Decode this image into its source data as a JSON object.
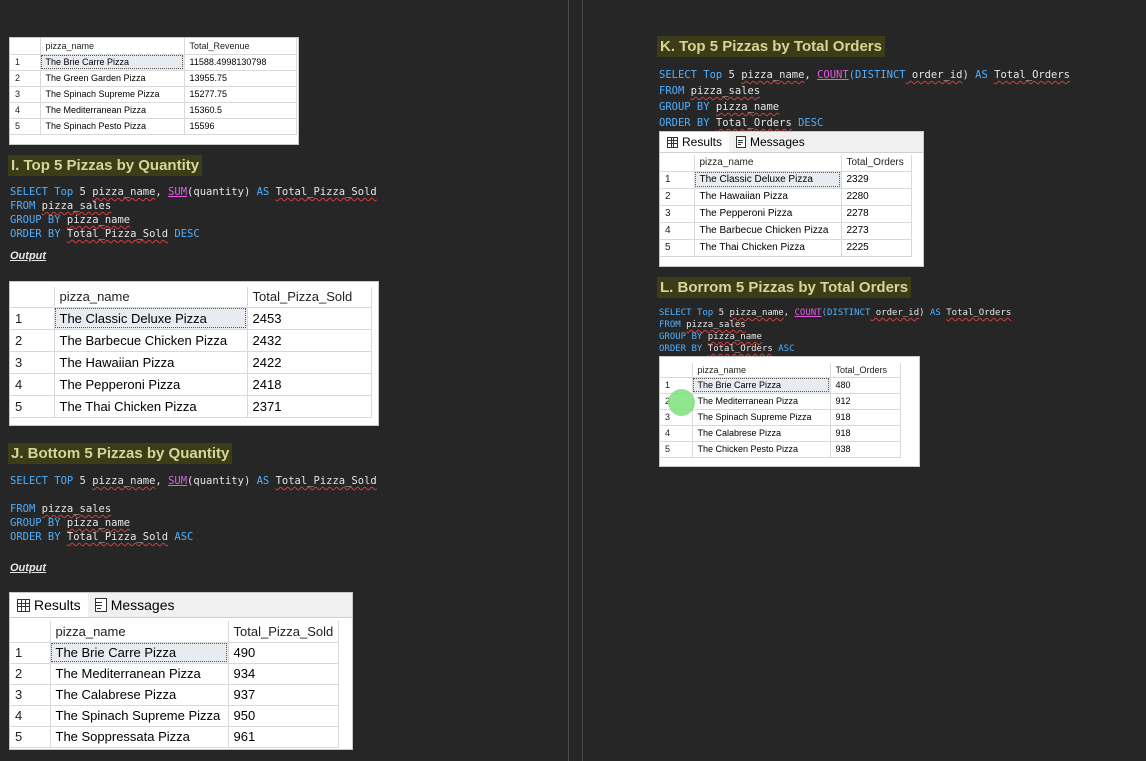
{
  "top_partial_table": {
    "columns": [
      "pizza_name",
      "Total_Revenue"
    ],
    "rows": [
      {
        "n": "1",
        "name": "The Brie Carre Pizza",
        "val": "11588.4998130798"
      },
      {
        "n": "2",
        "name": "The Green Garden Pizza",
        "val": "13955.75"
      },
      {
        "n": "3",
        "name": "The Spinach Supreme Pizza",
        "val": "15277.75"
      },
      {
        "n": "4",
        "name": "The Mediterranean Pizza",
        "val": "15360.5"
      },
      {
        "n": "5",
        "name": "The Spinach Pesto Pizza",
        "val": "15596"
      }
    ]
  },
  "section_i": {
    "heading": "I. Top 5 Pizzas by Quantity",
    "sql": {
      "l1": {
        "kw1": "SELECT",
        "top": "Top",
        "rest1": " 5 ",
        "col": "pizza_name",
        "comma": ", ",
        "fn": "SUM",
        "arg": "(quantity) ",
        "as": "AS",
        "alias": "Total_Pizza_Sold"
      },
      "l2": {
        "kw": "FROM",
        "tbl": "pizza_sales"
      },
      "l3": {
        "kw": "GROUP BY",
        "col": "pizza_name"
      },
      "l4": {
        "kw": "ORDER BY",
        "col": "Total_Pizza_Sold",
        "dir": "DESC"
      }
    },
    "output_label": "Output",
    "columns": [
      "pizza_name",
      "Total_Pizza_Sold"
    ],
    "rows": [
      {
        "n": "1",
        "name": "The Classic Deluxe Pizza",
        "val": "2453"
      },
      {
        "n": "2",
        "name": "The Barbecue Chicken Pizza",
        "val": "2432"
      },
      {
        "n": "3",
        "name": "The Hawaiian Pizza",
        "val": "2422"
      },
      {
        "n": "4",
        "name": "The Pepperoni Pizza",
        "val": "2418"
      },
      {
        "n": "5",
        "name": "The Thai Chicken Pizza",
        "val": "2371"
      }
    ]
  },
  "section_j": {
    "heading": "J. Bottom 5 Pizzas by Quantity",
    "sql": {
      "l1": {
        "kw1": "SELECT",
        "top": "TOP",
        "rest1": " 5 ",
        "col": "pizza_name",
        "comma": ", ",
        "fn": "SUM",
        "arg": "(quantity) ",
        "as": "AS",
        "alias": "Total_Pizza_Sold"
      },
      "l2": {
        "kw": "FROM",
        "tbl": "pizza_sales"
      },
      "l3": {
        "kw": "GROUP BY",
        "col": "pizza_name"
      },
      "l4": {
        "kw": "ORDER BY",
        "col": "Total_Pizza_Sold",
        "dir": "ASC"
      }
    },
    "output_label": "Output",
    "tabs": {
      "results": "Results",
      "messages": "Messages"
    },
    "columns": [
      "pizza_name",
      "Total_Pizza_Sold"
    ],
    "rows": [
      {
        "n": "1",
        "name": "The Brie Carre Pizza",
        "val": "490"
      },
      {
        "n": "2",
        "name": "The Mediterranean Pizza",
        "val": "934"
      },
      {
        "n": "3",
        "name": "The Calabrese Pizza",
        "val": "937"
      },
      {
        "n": "4",
        "name": "The Spinach Supreme Pizza",
        "val": "950"
      },
      {
        "n": "5",
        "name": "The Soppressata Pizza",
        "val": "961"
      }
    ]
  },
  "section_k": {
    "heading": "K. Top 5 Pizzas by Total Orders",
    "sql": {
      "l1": {
        "kw1": "SELECT",
        "top": "Top",
        "rest1": " 5 ",
        "col": "pizza_name",
        "comma": ", ",
        "fn": "COUNT",
        "arg_kw": "(DISTINCT",
        "arg_col": " order_id",
        "arg_end": ") ",
        "as": "AS",
        "alias": "Total_Orders"
      },
      "l2": {
        "kw": "FROM",
        "tbl": "pizza_sales"
      },
      "l3": {
        "kw": "GROUP BY",
        "col": "pizza_name"
      },
      "l4": {
        "kw": "ORDER BY",
        "col": "Total_Orders",
        "dir": "DESC"
      }
    },
    "tabs": {
      "results": "Results",
      "messages": "Messages"
    },
    "columns": [
      "pizza_name",
      "Total_Orders"
    ],
    "rows": [
      {
        "n": "1",
        "name": "The Classic Deluxe Pizza",
        "val": "2329"
      },
      {
        "n": "2",
        "name": "The Hawaiian Pizza",
        "val": "2280"
      },
      {
        "n": "3",
        "name": "The Pepperoni Pizza",
        "val": "2278"
      },
      {
        "n": "4",
        "name": "The Barbecue Chicken Pizza",
        "val": "2273"
      },
      {
        "n": "5",
        "name": "The Thai Chicken Pizza",
        "val": "2225"
      }
    ]
  },
  "section_l": {
    "heading": "L. Borrom 5 Pizzas by Total Orders",
    "sql": {
      "l1": {
        "kw1": "SELECT",
        "top": "Top",
        "rest1": " 5 ",
        "col": "pizza_name",
        "comma": ", ",
        "fn": "COUNT",
        "arg_kw": "(DISTINCT",
        "arg_col": " order_id",
        "arg_end": ") ",
        "as": "AS",
        "alias": "Total_Orders"
      },
      "l2": {
        "kw": "FROM",
        "tbl": "pizza_sales"
      },
      "l3": {
        "kw": "GROUP BY",
        "col": "pizza_name"
      },
      "l4": {
        "kw": "ORDER BY",
        "col": "Total_Orders",
        "dir": "ASC"
      }
    },
    "columns": [
      "pizza_name",
      "Total_Orders"
    ],
    "rows": [
      {
        "n": "1",
        "name": "The Brie Carre Pizza",
        "val": "480"
      },
      {
        "n": "2",
        "name": "The Mediterranean Pizza",
        "val": "912"
      },
      {
        "n": "3",
        "name": "The Spinach Supreme Pizza",
        "val": "918"
      },
      {
        "n": "4",
        "name": "The Calabrese Pizza",
        "val": "918"
      },
      {
        "n": "5",
        "name": "The Chicken Pesto Pizza",
        "val": "938"
      }
    ]
  },
  "colors": {
    "background": "#262626",
    "heading_bg": "#3c3d16",
    "heading_text": "#d7d49a",
    "keyword": "#4fb0ff",
    "function": "#e35be3"
  }
}
